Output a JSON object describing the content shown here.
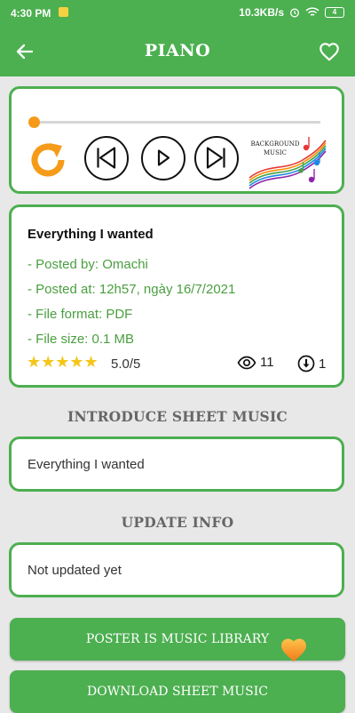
{
  "status_bar": {
    "time": "4:30 PM",
    "speed": "10.3KB/s",
    "battery": "4"
  },
  "header": {
    "title": "PIANO"
  },
  "player": {
    "progress": 0.0,
    "background_music_label": "BACKGROUND MUSIC"
  },
  "sheet": {
    "title": "Everything I wanted",
    "posted_by": "- Posted by: Omachi",
    "posted_at": "- Posted at: 12h57, ngày 16/7/2021",
    "file_format": "- File format: PDF",
    "file_size": "- File size: 0.1 MB",
    "stars": "★★★★★",
    "rating": "5.0/5",
    "views": "11",
    "downloads": "1"
  },
  "introduce": {
    "heading": "INTRODUCE SHEET MUSIC",
    "text": "Everything I wanted"
  },
  "update": {
    "heading": "UPDATE INFO",
    "text": "Not updated yet"
  },
  "actions": {
    "poster_label": "POSTER IS MUSIC LIBRARY",
    "download_label": "DOWNLOAD SHEET MUSIC"
  },
  "colors": {
    "primary": "#4caf50",
    "accent": "#f59b19",
    "meta_text": "#4a9e3f",
    "star": "#f5c518"
  }
}
